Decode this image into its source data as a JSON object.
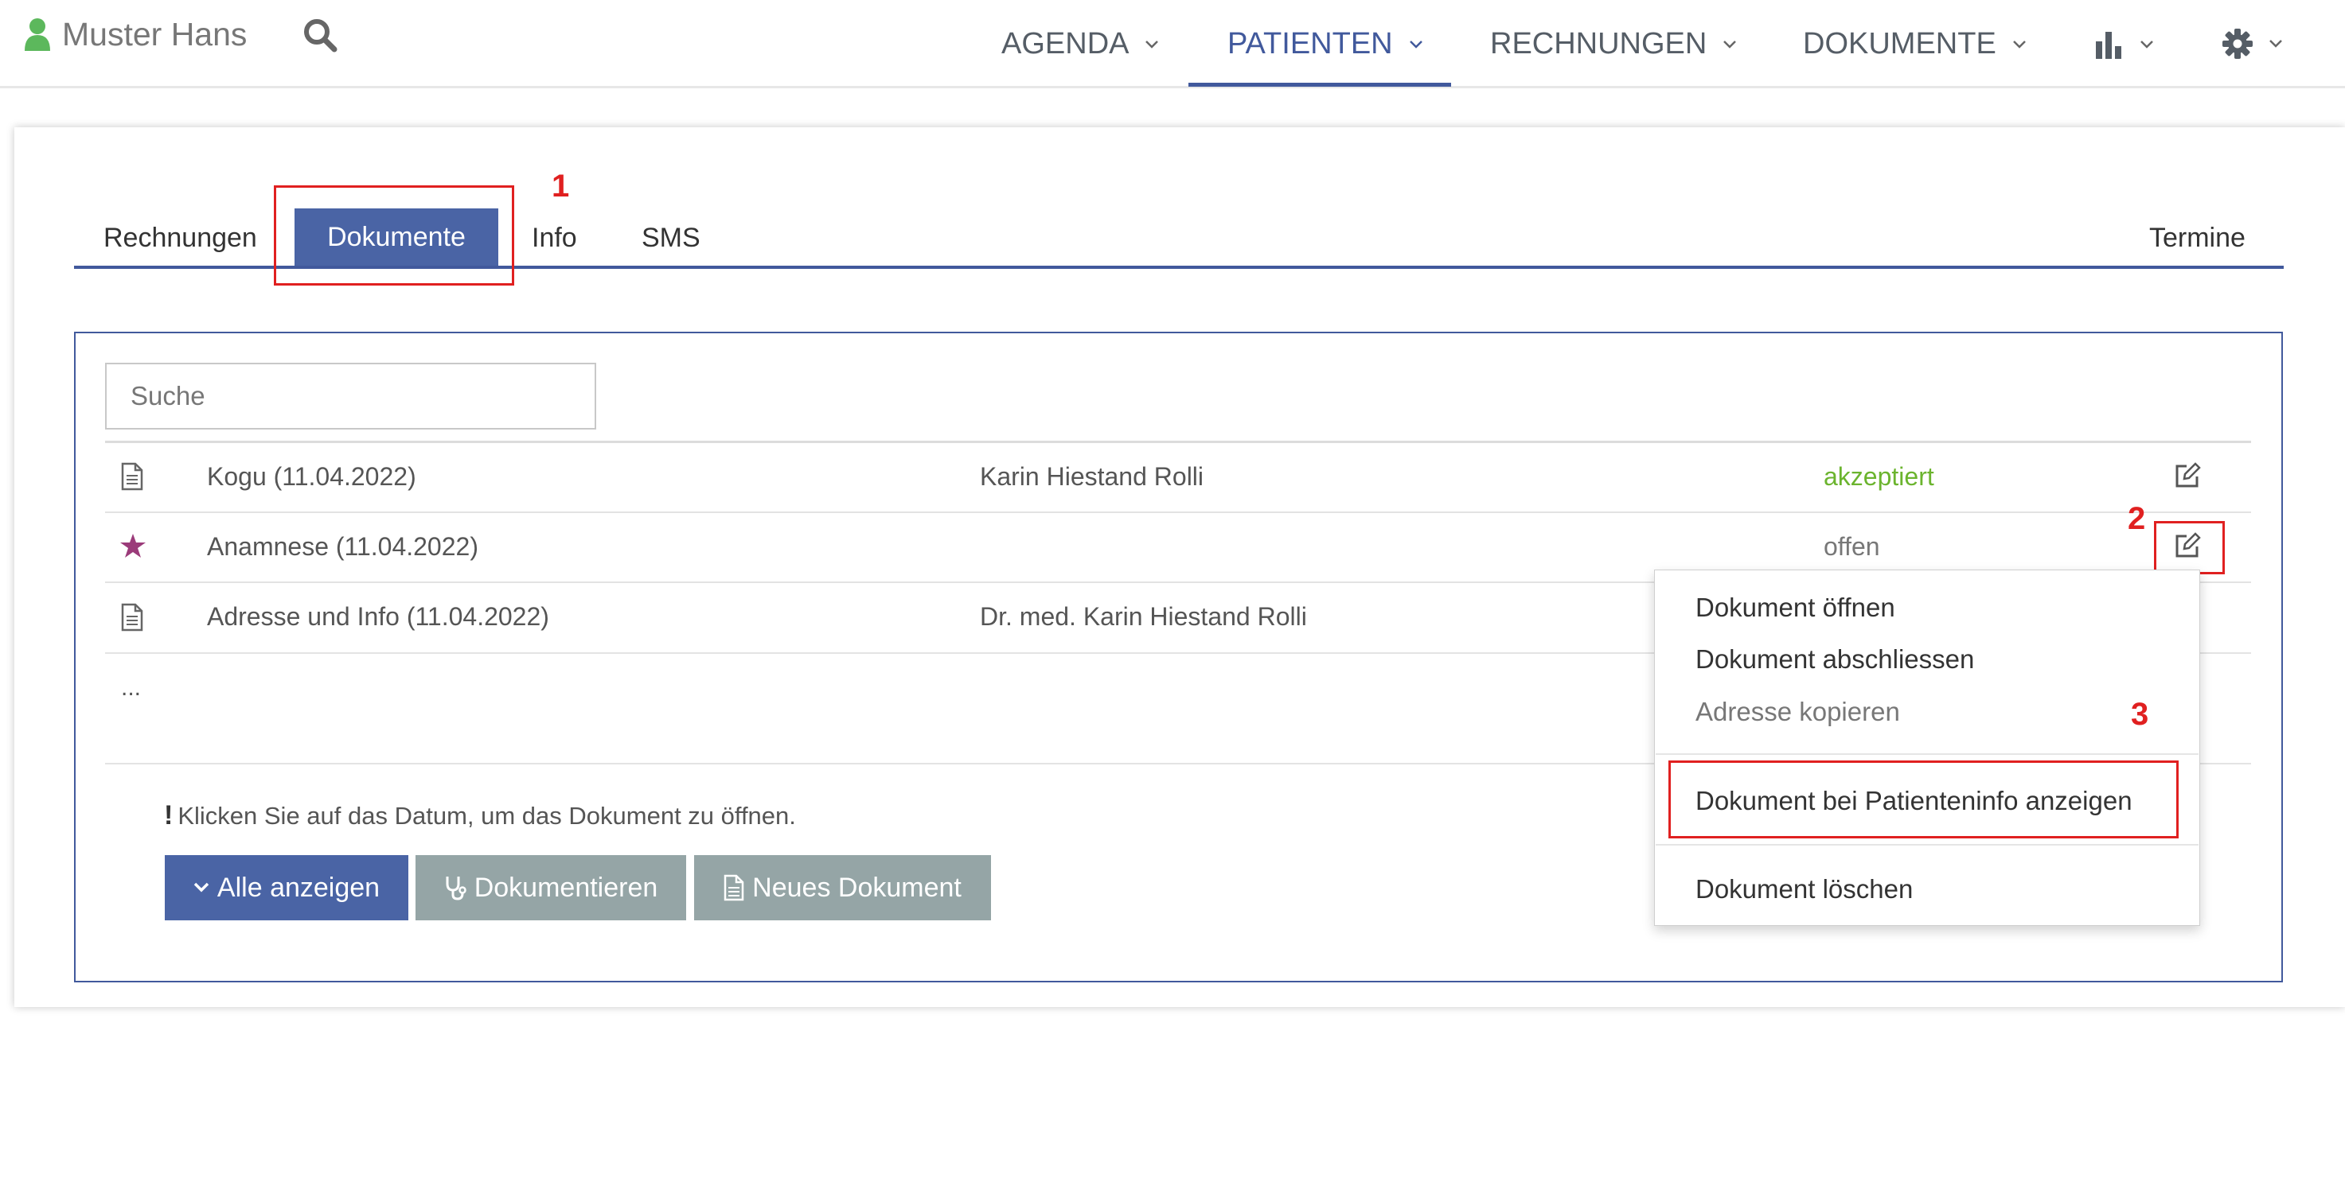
{
  "header": {
    "user_name": "Muster Hans",
    "nav": [
      {
        "label": "AGENDA"
      },
      {
        "label": "PATIENTEN",
        "active": true
      },
      {
        "label": "RECHNUNGEN"
      },
      {
        "label": "DOKUMENTE"
      }
    ],
    "icons": [
      "user-icon",
      "search-icon",
      "bar-chart-icon",
      "gear-icon"
    ]
  },
  "tabs": {
    "items": [
      "Rechnungen",
      "Dokumente",
      "Info",
      "SMS"
    ],
    "active": "Dokumente",
    "right_tab": "Termine"
  },
  "annotations": {
    "step1": "1",
    "step2": "2",
    "step3": "3"
  },
  "search": {
    "placeholder": "Suche",
    "value": ""
  },
  "documents": {
    "rows": [
      {
        "icon": "document-icon",
        "title": "Kogu (11.04.2022)",
        "author": "Karin Hiestand Rolli",
        "status": "akzeptiert"
      },
      {
        "icon": "star-icon",
        "title": "Anamnese (11.04.2022)",
        "author": "",
        "status": "offen"
      },
      {
        "icon": "document-icon",
        "title": "Adresse und Info (11.04.2022)",
        "author": "Dr. med. Karin Hiestand Rolli",
        "status": ""
      }
    ],
    "more": "..."
  },
  "hint": {
    "mark": "!",
    "text": "Klicken Sie auf das Datum, um das Dokument zu öffnen."
  },
  "buttons": {
    "show_all": "Alle anzeigen",
    "document": "Dokumentieren",
    "new_document": "Neues Dokument"
  },
  "context_menu": {
    "items": [
      {
        "label": "Dokument öffnen",
        "enabled": true
      },
      {
        "label": "Dokument abschliessen",
        "enabled": true
      },
      {
        "label": "Adresse kopieren",
        "enabled": false
      },
      {
        "label": "Dokument bei Patienteninfo anzeigen",
        "enabled": true,
        "highlighted": true
      },
      {
        "label": "Dokument löschen",
        "enabled": true
      }
    ]
  },
  "colors": {
    "primary": "#4a64a5",
    "nav_active": "#41599c",
    "status_accepted": "#6bb42e",
    "annotation_red": "#e02020",
    "star": "#9b3b7a",
    "user_icon": "#5cb85c",
    "button_gray": "#95a5a6"
  }
}
